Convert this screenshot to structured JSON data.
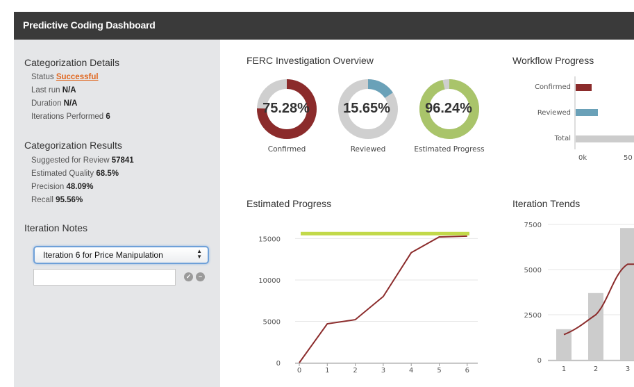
{
  "header": {
    "title": "Predictive Coding Dashboard"
  },
  "sidebar": {
    "details_title": "Categorization Details",
    "details": [
      {
        "label": "Status",
        "value": "Successful"
      },
      {
        "label": "Last run",
        "value": "N/A"
      },
      {
        "label": "Duration",
        "value": "N/A"
      },
      {
        "label": "Iterations Performed",
        "value": "6"
      }
    ],
    "results_title": "Categorization Results",
    "results": [
      {
        "label": "Suggested for Review",
        "value": "57841"
      },
      {
        "label": "Estimated Quality",
        "value": "68.5%"
      },
      {
        "label": "Precision",
        "value": "48.09%"
      },
      {
        "label": "Recall",
        "value": "95.56%"
      }
    ],
    "notes_title": "Iteration Notes",
    "notes_select": "Iteration 6 for Price Manipulation",
    "notes_input": ""
  },
  "overview": {
    "title": "FERC Investigation Overview",
    "donuts": [
      {
        "value": "75.28%",
        "fraction": 0.7528,
        "label": "Confirmed",
        "color": "#8b2b2b"
      },
      {
        "value": "15.65%",
        "fraction": 0.1565,
        "label": "Reviewed",
        "color": "#6aa1b8"
      },
      {
        "value": "96.24%",
        "fraction": 0.9624,
        "label": "Estimated Progress",
        "color": "#a9c46a"
      }
    ],
    "track_color": "#cfcfcf"
  },
  "workflow": {
    "title": "Workflow Progress",
    "bars": [
      {
        "label": "Confirmed",
        "color": "#8b2b2b"
      },
      {
        "label": "Reviewed",
        "color": "#6aa1b8"
      },
      {
        "label": "Total",
        "color": "#cccccc"
      }
    ],
    "x_ticks": [
      "0k",
      "50"
    ]
  },
  "chart_data": [
    {
      "type": "line",
      "title": "Estimated Progress",
      "x": [
        0,
        1,
        2,
        3,
        4,
        5,
        6
      ],
      "series": [
        {
          "values": [
            0,
            4700,
            5200,
            8000,
            13300,
            15200,
            15300
          ],
          "color": "#8b2b2b"
        }
      ],
      "target_line": {
        "value": 15600,
        "color": "#c2d94a"
      },
      "x_ticks": [
        "0",
        "1",
        "2",
        "3",
        "4",
        "5",
        "6"
      ],
      "y_ticks": [
        "0",
        "5000",
        "10000",
        "15000"
      ],
      "ylim": [
        0,
        16800
      ],
      "grid": true
    },
    {
      "type": "bar",
      "title": "Iteration Trends",
      "categories": [
        "1",
        "2",
        "3"
      ],
      "values": [
        1700,
        3700,
        7300
      ],
      "bar_color": "#cccccc",
      "line": {
        "values": [
          1400,
          2500,
          5300
        ],
        "color": "#8b2b2b"
      },
      "y_ticks": [
        "0",
        "2500",
        "5000",
        "7500"
      ],
      "ylim": [
        0,
        7500
      ],
      "grid": true
    }
  ]
}
